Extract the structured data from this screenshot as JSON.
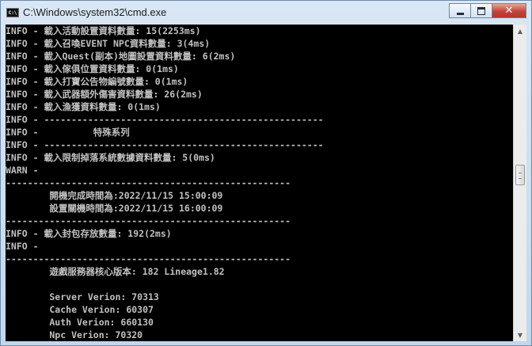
{
  "window": {
    "title": "C:\\Windows\\system32\\cmd.exe",
    "icon": "cmd-icon",
    "icon_text": "C:\\",
    "controls": {
      "minimize": "minimize-icon",
      "maximize": "maximize-icon",
      "close": "close-icon",
      "close_glyph": "✕"
    }
  },
  "console": {
    "lines": [
      "INFO - 載入活動設置資料數量: 15(2253ms)",
      "INFO - 載入召喚EVENT NPC資料數量: 3(4ms)",
      "INFO - 載入Quest(副本)地圖設置資料數量: 6(2ms)",
      "INFO - 載入傢俱位置資料數量: 0(1ms)",
      "INFO - 載入打寶公告物編號數量: 0(1ms)",
      "INFO - 載入武器額外傷害資料數量: 26(2ms)",
      "INFO - 載入漁獲資料數量: 0(1ms)",
      "INFO - ---------------------------------------------------",
      "INFO -          特殊系列",
      "INFO - ---------------------------------------------------",
      "INFO - 載入限制掉落系統數據資料數量: 5(0ms)",
      "WARN -",
      "----------------------------------------------------",
      "        開機完成時間為:2022/11/15 15:00:09",
      "        設置關機時間為:2022/11/15 16:00:09",
      "----------------------------------------------------",
      "INFO - 載入封包存放數量: 192(2ms)",
      "INFO -",
      "----------------------------------------------------",
      "        遊戲服務器核心版本: 182 Lineage1.82",
      "",
      "        Server Verion: 70313",
      "        Cache Verion: 60307",
      "        Auth Verion: 660130",
      "        Npc Verion: 70320"
    ]
  },
  "scrollbar": {
    "up": "scroll-up-arrow-icon",
    "down": "scroll-down-arrow-icon",
    "up_glyph": "▲",
    "down_glyph": "▼"
  },
  "colors": {
    "console_bg": "#000000",
    "console_text": "#c0c0c0",
    "title_bar": "#c3d7ec",
    "close_button": "#c3453a"
  }
}
